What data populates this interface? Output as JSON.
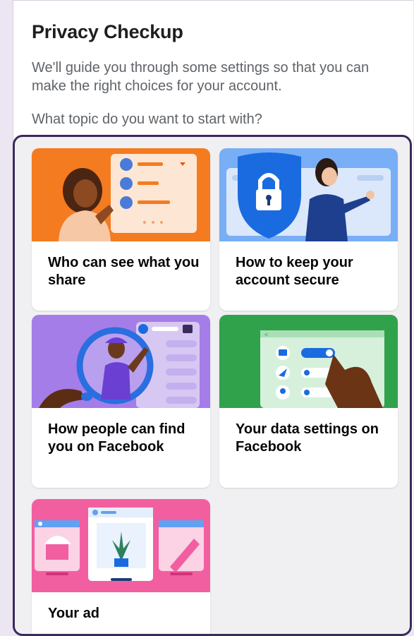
{
  "header": {
    "title": "Privacy Checkup",
    "subtitle": "We'll guide you through some settings so that you can make the right choices for your account.",
    "question": "What topic do you want to start with?"
  },
  "topics": [
    {
      "label": "Who can see what you share",
      "art_color": "#f47b20"
    },
    {
      "label": "How to keep your account secure",
      "art_color": "#78aef5"
    },
    {
      "label": "How people can find you on Facebook",
      "art_color": "#a57de8"
    },
    {
      "label": "Your data settings on Facebook",
      "art_color": "#31a24c"
    },
    {
      "label": "Your ad",
      "art_color": "#f25fa0"
    }
  ],
  "colors": {
    "frame_border": "#3b2a5c",
    "page_background": "#ece6f3"
  }
}
